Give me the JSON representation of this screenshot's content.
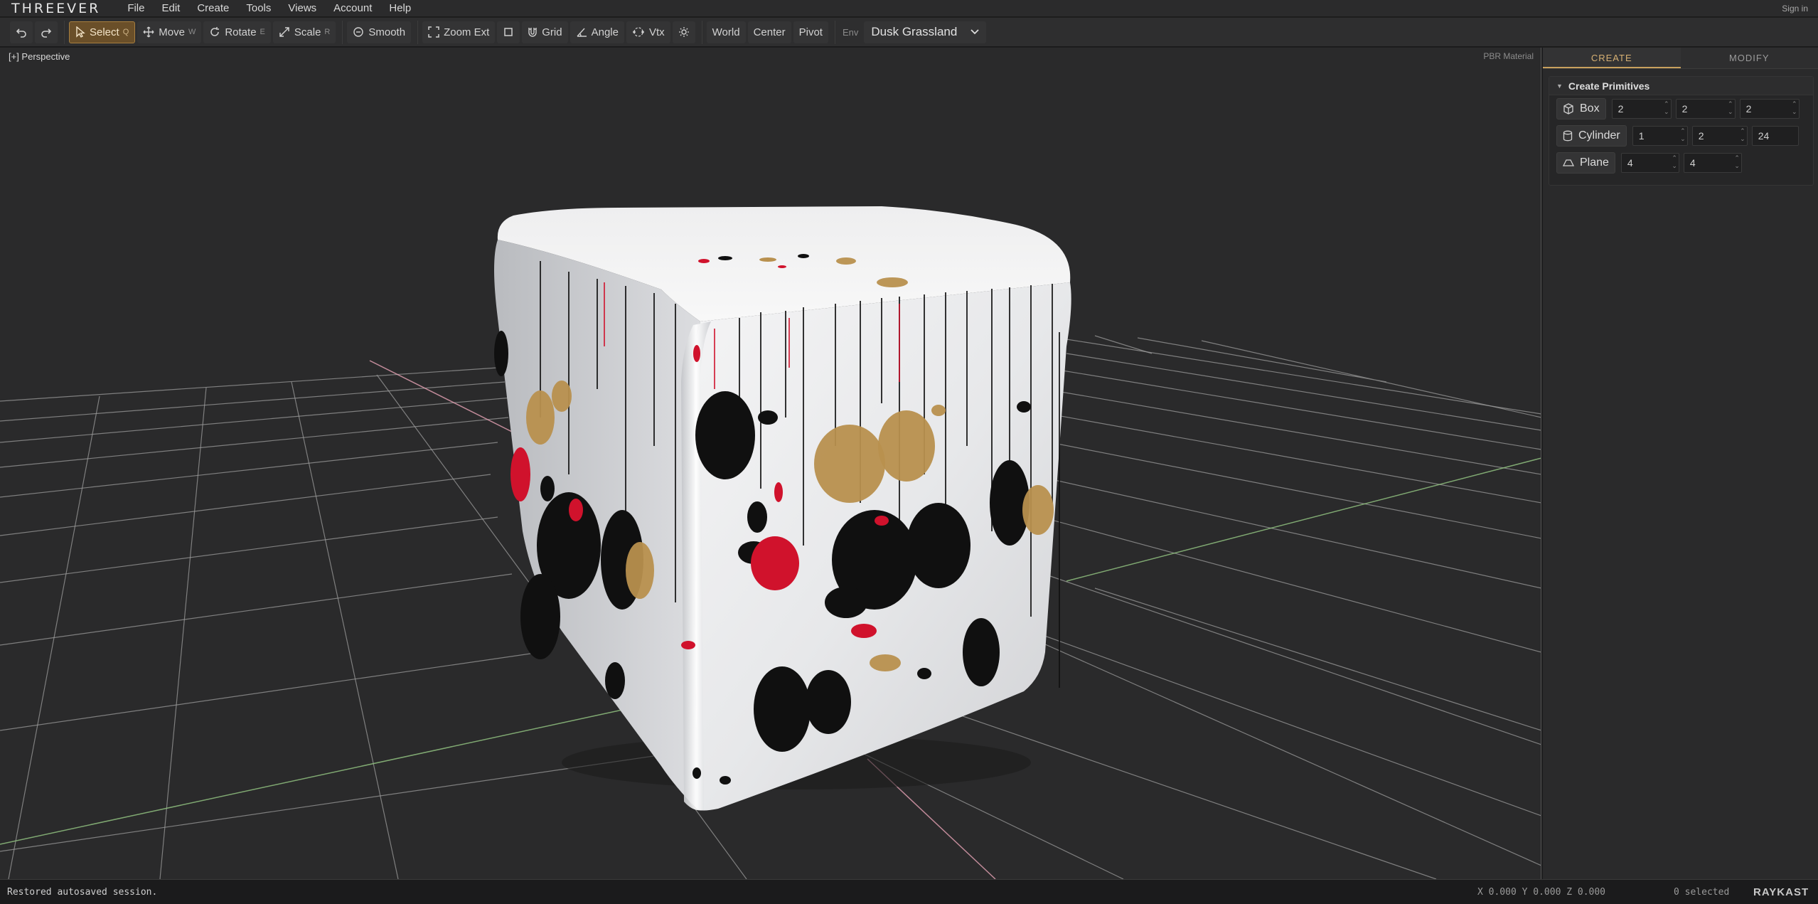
{
  "app": {
    "logo": "THREEVER",
    "signin": "Sign in"
  },
  "menu": [
    "File",
    "Edit",
    "Create",
    "Tools",
    "Views",
    "Account",
    "Help"
  ],
  "toolbar": {
    "select": {
      "label": "Select",
      "key": "Q"
    },
    "move": {
      "label": "Move",
      "key": "W"
    },
    "rotate": {
      "label": "Rotate",
      "key": "E"
    },
    "scale": {
      "label": "Scale",
      "key": "R"
    },
    "smooth": "Smooth",
    "zoom_ext": "Zoom Ext",
    "grid": "Grid",
    "angle": "Angle",
    "vtx": "Vtx",
    "world": "World",
    "center": "Center",
    "pivot": "Pivot",
    "env_label": "Env",
    "env_value": "Dusk Grassland"
  },
  "viewport": {
    "label": "[+] Perspective",
    "material": "PBR Material"
  },
  "panel": {
    "tabs": [
      "CREATE",
      "MODIFY"
    ],
    "section_title": "Create Primitives",
    "primitives": [
      {
        "label": "Box",
        "icon": "cube-icon",
        "values": [
          "2",
          "2",
          "2"
        ]
      },
      {
        "label": "Cylinder",
        "icon": "cylinder-icon",
        "values": [
          "1",
          "2",
          "24"
        ]
      },
      {
        "label": "Plane",
        "icon": "plane-icon",
        "values": [
          "4",
          "4"
        ]
      }
    ]
  },
  "status": {
    "message": "Restored autosaved session.",
    "coords": "X 0.000 Y 0.000 Z 0.000",
    "selected": "0 selected",
    "brand": "RAYKAST"
  },
  "colors": {
    "accent": "#c9a15e",
    "active_button": "#6a4f29",
    "grid": "#a9a9a9",
    "axis_x": "#e6a3b5",
    "axis_z": "#8fbf7f",
    "splatter_black": "#101010",
    "splatter_red": "#d0122c",
    "splatter_gold": "#b8904e"
  }
}
